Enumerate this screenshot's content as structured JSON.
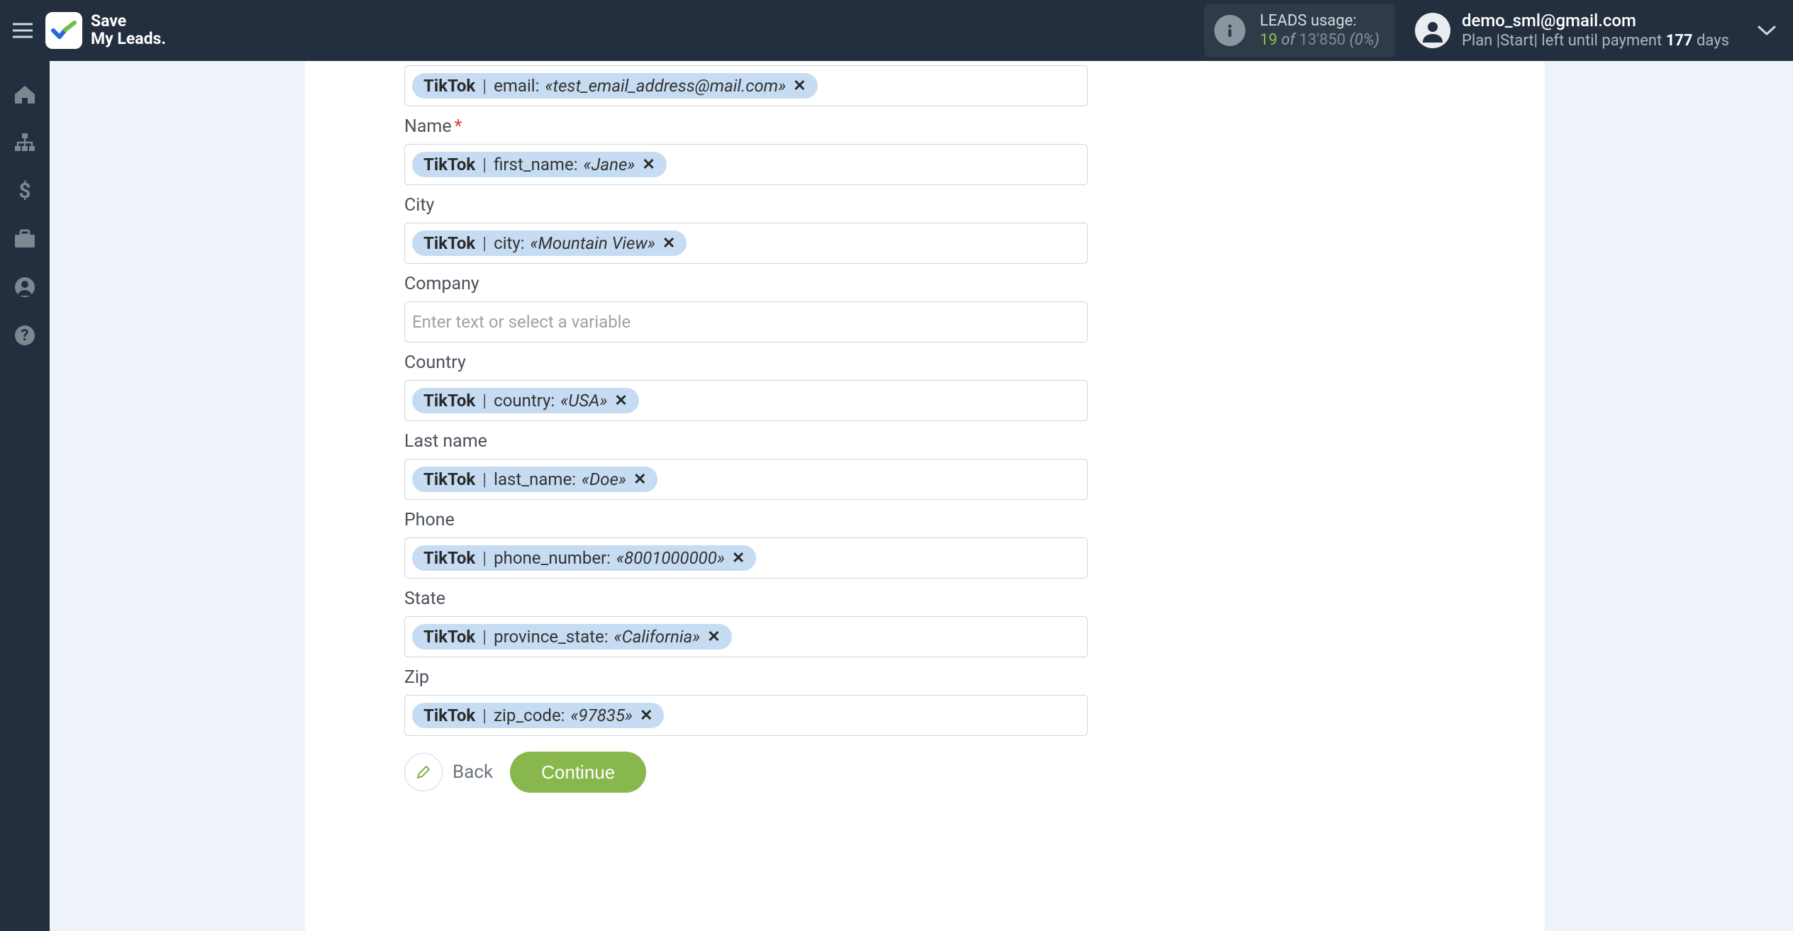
{
  "app": {
    "name_line1": "Save",
    "name_line2": "My Leads."
  },
  "header": {
    "leads": {
      "label": "LEADS usage:",
      "used": "19",
      "of_word": "of",
      "total": "13'850",
      "pct": "(0%)"
    },
    "user": {
      "email": "demo_sml@gmail.com",
      "plan_prefix": "Plan |Start| left until payment ",
      "days": "177",
      "days_suffix": " days"
    }
  },
  "chip_source": "TikTok",
  "placeholder_text": "Enter text or select a variable",
  "fields": [
    {
      "id": "email",
      "label": "",
      "required": false,
      "key": "email",
      "value": "test_email_address@mail.com",
      "no_label": true
    },
    {
      "id": "name",
      "label": "Name",
      "required": true,
      "key": "first_name",
      "value": "Jane"
    },
    {
      "id": "city",
      "label": "City",
      "required": false,
      "key": "city",
      "value": "Mountain View"
    },
    {
      "id": "company",
      "label": "Company",
      "required": false,
      "key": "",
      "value": "",
      "empty": true
    },
    {
      "id": "country",
      "label": "Country",
      "required": false,
      "key": "country",
      "value": "USA"
    },
    {
      "id": "lastname",
      "label": "Last name",
      "required": false,
      "key": "last_name",
      "value": "Doe"
    },
    {
      "id": "phone",
      "label": "Phone",
      "required": false,
      "key": "phone_number",
      "value": "8001000000"
    },
    {
      "id": "state",
      "label": "State",
      "required": false,
      "key": "province_state",
      "value": "California"
    },
    {
      "id": "zip",
      "label": "Zip",
      "required": false,
      "key": "zip_code",
      "value": "97835"
    }
  ],
  "buttons": {
    "back": "Back",
    "continue": "Continue"
  }
}
